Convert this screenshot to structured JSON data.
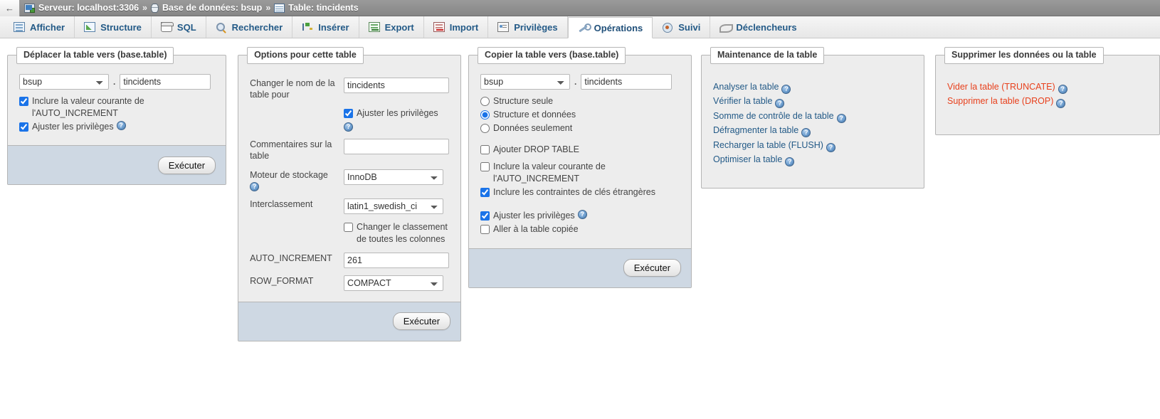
{
  "topbar": {
    "back_label": "←",
    "server": {
      "icon": "server-icon",
      "label": "Serveur: localhost:3306"
    },
    "database": {
      "icon": "database-icon",
      "label": "Base de données: bsup"
    },
    "table": {
      "icon": "table-icon",
      "label": "Table: tincidents"
    },
    "separator": "»"
  },
  "tabs": [
    {
      "id": "afficher",
      "label": "Afficher",
      "icon": "browse-icon",
      "active": false
    },
    {
      "id": "structure",
      "label": "Structure",
      "icon": "structure-icon",
      "active": false
    },
    {
      "id": "sql",
      "label": "SQL",
      "icon": "sql-icon",
      "active": false
    },
    {
      "id": "rechercher",
      "label": "Rechercher",
      "icon": "search-icon",
      "active": false
    },
    {
      "id": "inserer",
      "label": "Insérer",
      "icon": "insert-icon",
      "active": false
    },
    {
      "id": "export",
      "label": "Export",
      "icon": "export-icon",
      "active": false
    },
    {
      "id": "import",
      "label": "Import",
      "icon": "import-icon",
      "active": false
    },
    {
      "id": "privileges",
      "label": "Privilèges",
      "icon": "privileges-icon",
      "active": false
    },
    {
      "id": "operations",
      "label": "Opérations",
      "icon": "wrench-icon",
      "active": true
    },
    {
      "id": "suivi",
      "label": "Suivi",
      "icon": "eye-icon",
      "active": false
    },
    {
      "id": "declencheurs",
      "label": "Déclencheurs",
      "icon": "trigger-icon",
      "active": false
    }
  ],
  "move_table": {
    "legend": "Déplacer la table vers (base.table)",
    "db_value": "bsup",
    "db_options": [
      "bsup"
    ],
    "dot": ".",
    "table_value": "tincidents",
    "cb_auto_increment": {
      "label": "Inclure la valeur courante de l'AUTO_INCREMENT",
      "checked": true
    },
    "cb_privileges": {
      "label": "Ajuster les privilèges",
      "checked": true,
      "help": "?"
    },
    "submit_label": "Exécuter"
  },
  "table_options": {
    "legend": "Options pour cette table",
    "rows": [
      {
        "label": "Changer le nom de la table pour",
        "type": "text",
        "value": "tincidents"
      },
      {
        "label": "Commentaires sur la table",
        "type": "text",
        "value": ""
      },
      {
        "label": "Moteur de stockage",
        "type": "select",
        "value": "InnoDB",
        "options": [
          "InnoDB"
        ],
        "help": "?"
      },
      {
        "label": "Interclassement",
        "type": "select",
        "value": "latin1_swedish_ci",
        "options": [
          "latin1_swedish_ci"
        ]
      },
      {
        "label": "AUTO_INCREMENT",
        "type": "text",
        "value": "261"
      },
      {
        "label": "ROW_FORMAT",
        "type": "select",
        "value": "COMPACT",
        "options": [
          "COMPACT"
        ]
      }
    ],
    "cb_privileges": {
      "label": "Ajuster les privilèges",
      "checked": true,
      "help": "?"
    },
    "cb_change_collation": {
      "label": "Changer le classement de toutes les colonnes",
      "checked": false
    },
    "submit_label": "Exécuter"
  },
  "copy_table": {
    "legend": "Copier la table vers (base.table)",
    "db_value": "bsup",
    "db_options": [
      "bsup"
    ],
    "dot": ".",
    "table_value": "tincidents",
    "radios": [
      {
        "label": "Structure seule",
        "checked": false
      },
      {
        "label": "Structure et données",
        "checked": true
      },
      {
        "label": "Données seulement",
        "checked": false
      }
    ],
    "cb_drop_table": {
      "label": "Ajouter DROP TABLE",
      "checked": false
    },
    "cb_auto_increment": {
      "label": "Inclure la valeur courante de l'AUTO_INCREMENT",
      "checked": false
    },
    "cb_foreign_keys": {
      "label": "Inclure les contraintes de clés étrangères",
      "checked": true
    },
    "cb_privileges": {
      "label": "Ajuster les privilèges",
      "checked": true,
      "help": "?"
    },
    "cb_goto_copy": {
      "label": "Aller à la table copiée",
      "checked": false
    },
    "submit_label": "Exécuter"
  },
  "maintenance": {
    "legend": "Maintenance de la table",
    "links": [
      {
        "label": "Analyser la table",
        "help": "?"
      },
      {
        "label": "Vérifier la table",
        "help": "?"
      },
      {
        "label": "Somme de contrôle de la table",
        "help": "?"
      },
      {
        "label": "Défragmenter la table",
        "help": "?"
      },
      {
        "label": "Recharger la table (FLUSH)",
        "help": "?"
      },
      {
        "label": "Optimiser la table",
        "help": "?"
      }
    ]
  },
  "delete_data": {
    "legend": "Supprimer les données ou la table",
    "links": [
      {
        "label": "Vider la table (TRUNCATE)",
        "help": "?"
      },
      {
        "label": "Supprimer la table (DROP)",
        "help": "?"
      }
    ]
  },
  "colors": {
    "link": "#235a87",
    "danger": "#e8401c",
    "panel_bg": "#ededed",
    "footer_bg": "#ced8e3",
    "topbar_bg": "#8e8e8e"
  }
}
